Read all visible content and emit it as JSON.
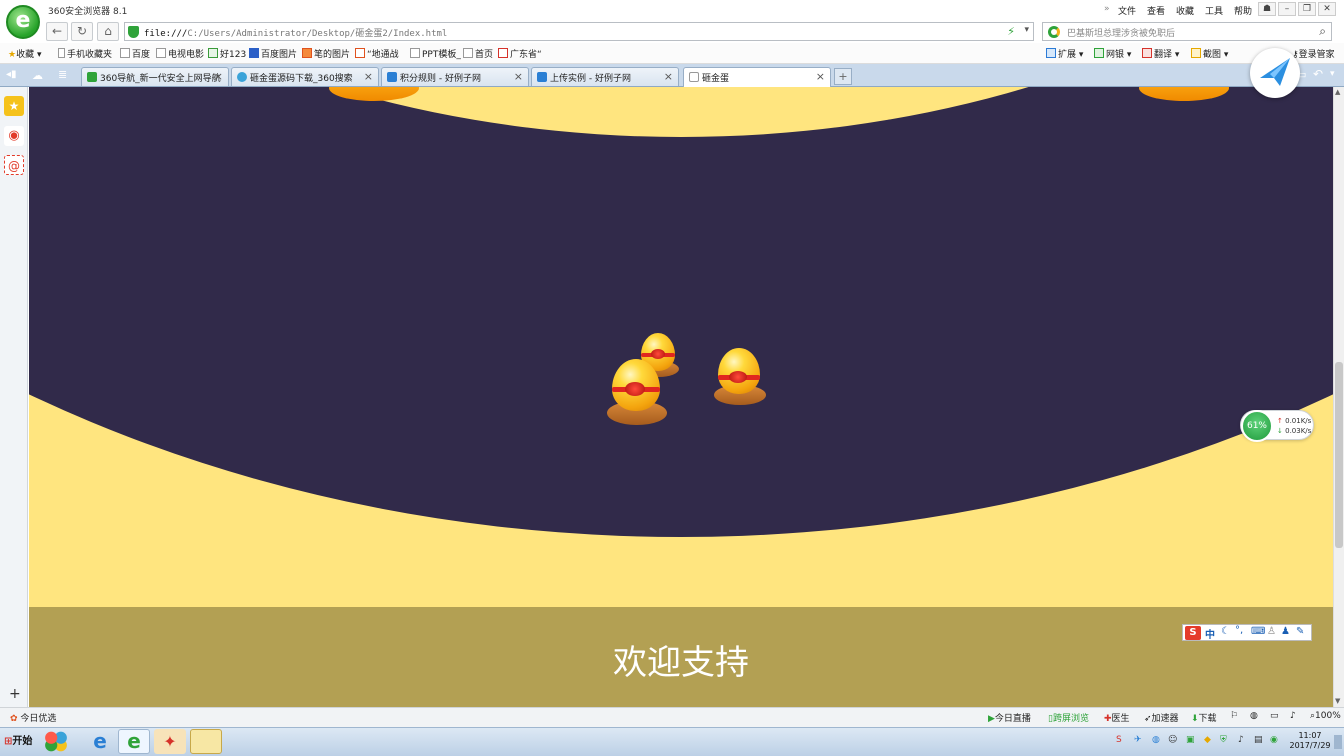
{
  "window": {
    "app_title": "360安全浏览器 8.1",
    "menu": [
      "文件",
      "查看",
      "收藏",
      "工具",
      "帮助"
    ],
    "logo_glyph": "e"
  },
  "address": {
    "url_prefix": "file:///",
    "url_path": "C:/Users/Administrator/Desktop/砸金蛋2/Index.html",
    "search_placeholder": "巴基斯坦总理涉贪被免职后"
  },
  "bookmarks": {
    "left": [
      "收藏",
      "手机收藏夹",
      "百度",
      "电视电影",
      "好123",
      "百度图片",
      "笔的图片",
      "“地通战",
      "PPT模板_",
      "首页",
      "广东省“"
    ],
    "right": [
      "扩展",
      "网银",
      "翻译",
      "截图",
      "登录管家"
    ]
  },
  "tabs": [
    {
      "label": "360导航_新一代安全上网导航",
      "active": false,
      "color": "#2fa33a"
    },
    {
      "label": "砸金蛋源码下载_360搜索",
      "active": false,
      "color": "#3aa3d9"
    },
    {
      "label": "积分规则 - 好例子网",
      "active": false,
      "color": "#2a7fd4"
    },
    {
      "label": "上传实例 - 好例子网",
      "active": false,
      "color": "#2a7fd4"
    },
    {
      "label": "砸金蛋",
      "active": true,
      "color": "#ffffff"
    }
  ],
  "page": {
    "welcome": "欢迎支持",
    "colors": {
      "background": "#ffe57f",
      "top_arc": "#312a4a",
      "footer": "#b3a053"
    }
  },
  "net_widget": {
    "percent": "61%",
    "up": "0.01K/s",
    "down": "0.03K/s"
  },
  "ime": {
    "logo": "S",
    "mode": "中"
  },
  "status": {
    "left": "今日优选",
    "right": [
      "今日直播",
      "跨屏浏览",
      "医生",
      "加速器",
      "下载"
    ],
    "zoom": "100%"
  },
  "taskbar": {
    "start": "开始",
    "time": "11:07",
    "date": "2017/7/29"
  }
}
